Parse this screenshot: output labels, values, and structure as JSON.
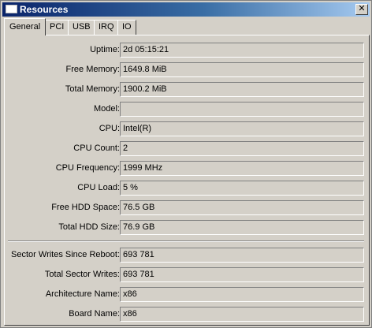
{
  "window": {
    "title": "Resources",
    "close_symbol": "✕"
  },
  "tabs": [
    "General",
    "PCI",
    "USB",
    "IRQ",
    "IO"
  ],
  "fields": [
    {
      "label": "Uptime:",
      "value": "2d 05:15:21"
    },
    {
      "label": "Free Memory:",
      "value": "1649.8 MiB"
    },
    {
      "label": "Total Memory:",
      "value": "1900.2 MiB"
    },
    {
      "label": "Model:",
      "value": ""
    },
    {
      "label": "CPU:",
      "value": "Intel(R)"
    },
    {
      "label": "CPU Count:",
      "value": "2"
    },
    {
      "label": "CPU Frequency:",
      "value": "1999 MHz"
    },
    {
      "label": "CPU Load:",
      "value": "5 %"
    },
    {
      "label": "Free HDD Space:",
      "value": "76.5 GB"
    },
    {
      "label": "Total HDD Size:",
      "value": "76.9 GB"
    },
    {
      "label": "Sector Writes Since Reboot:",
      "value": "693 781"
    },
    {
      "label": "Total Sector Writes:",
      "value": "693 781"
    },
    {
      "label": "Architecture Name:",
      "value": "x86"
    },
    {
      "label": "Board Name:",
      "value": "x86"
    }
  ]
}
